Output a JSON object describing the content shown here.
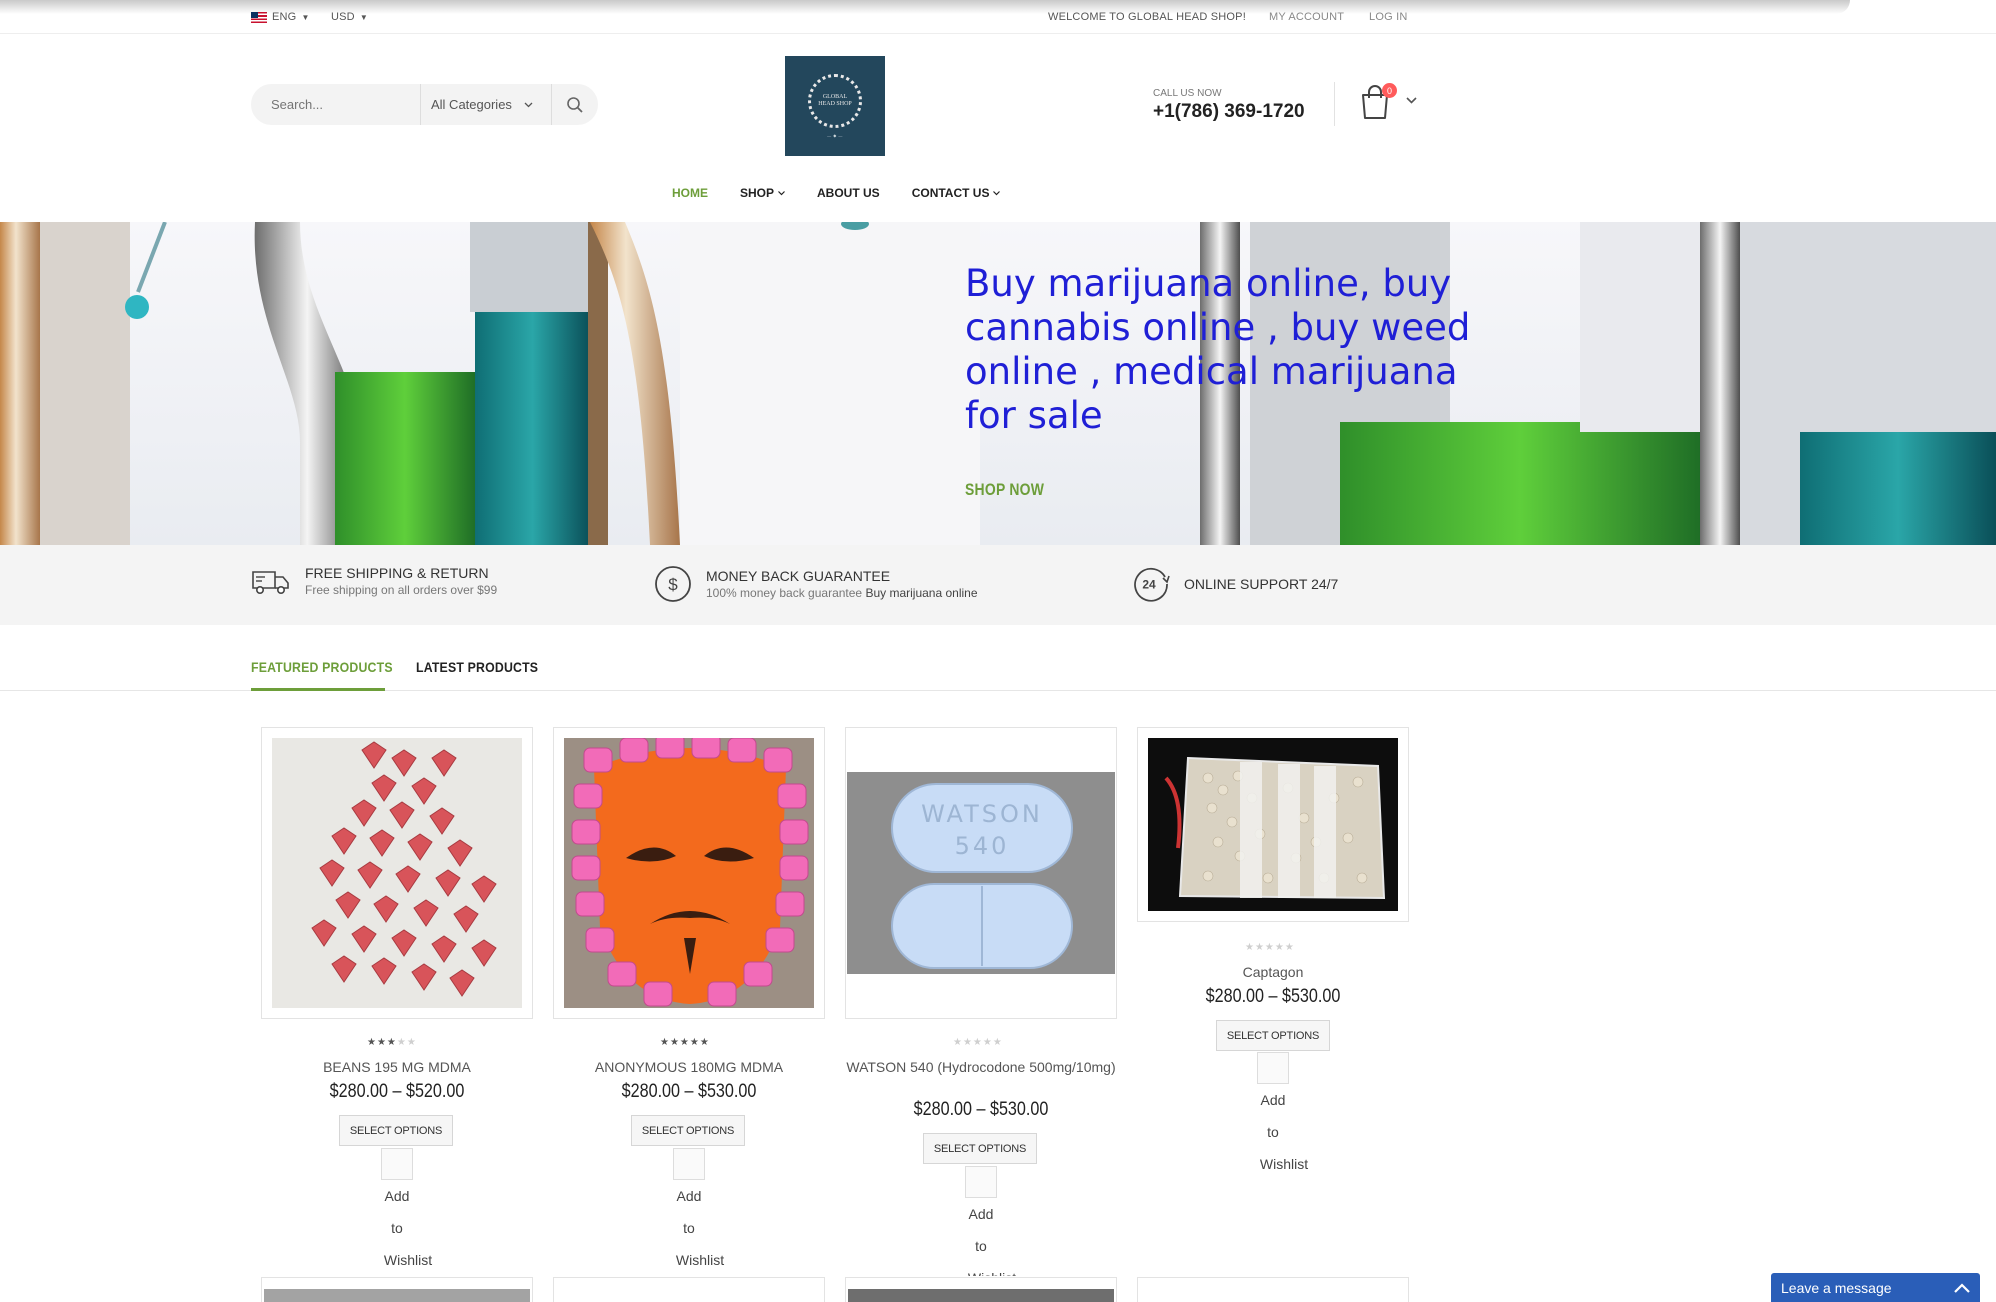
{
  "topbar": {
    "language": "ENG",
    "currency": "USD",
    "welcome": "WELCOME TO GLOBAL HEAD SHOP!",
    "my_account": "MY ACCOUNT",
    "login": "LOG IN"
  },
  "header": {
    "search_placeholder": "Search...",
    "category": "All Categories",
    "logo_text": "GLOBAL HEAD SHOP",
    "call_label": "CALL US NOW",
    "phone": "+1(786) 369-1720",
    "cart_count": "0"
  },
  "nav": {
    "items": [
      {
        "label": "HOME",
        "active": true,
        "dropdown": false
      },
      {
        "label": "SHOP",
        "active": false,
        "dropdown": true
      },
      {
        "label": "ABOUT US",
        "active": false,
        "dropdown": false
      },
      {
        "label": "CONTACT US",
        "active": false,
        "dropdown": true
      }
    ]
  },
  "hero": {
    "title": "Buy marijuana online, buy cannabis online , buy weed online , medical marijuana for sale",
    "cta": "SHOP NOW"
  },
  "features": [
    {
      "title": "FREE SHIPPING & RETURN",
      "subtitle": "Free shipping on all orders over $99",
      "extra": "",
      "icon": "truck-icon"
    },
    {
      "title": "MONEY BACK GUARANTEE",
      "subtitle": "100% money back guarantee",
      "extra": "Buy marijuana online",
      "icon": "dollar-circle-icon"
    },
    {
      "title": "ONLINE SUPPORT 24/7",
      "subtitle": "",
      "extra": "",
      "icon": "support-24-icon"
    }
  ],
  "tabs": {
    "featured": "FEATURED PRODUCTS",
    "latest": "LATEST PRODUCTS"
  },
  "products": [
    {
      "name": "BEANS 195 MG MDMA",
      "price": "$280.00 – $520.00",
      "rating": 3,
      "button": "SELECT OPTIONS",
      "wishlist": [
        "Add",
        "to",
        "Wishlist"
      ]
    },
    {
      "name": "ANONYMOUS 180MG MDMA",
      "price": "$280.00 – $530.00",
      "rating": 5,
      "button": "SELECT OPTIONS",
      "wishlist": [
        "Add",
        "to",
        "Wishlist"
      ]
    },
    {
      "name": "WATSON 540 (Hydrocodone 500mg/10mg)",
      "price": "$280.00 – $530.00",
      "rating": 0,
      "button": "SELECT OPTIONS",
      "wishlist": [
        "Add",
        "to",
        "Wishlist"
      ]
    },
    {
      "name": "Captagon",
      "price": "$280.00 – $530.00",
      "rating": 0,
      "button": "SELECT OPTIONS",
      "wishlist": [
        "Add",
        "to",
        "Wishlist"
      ]
    }
  ],
  "pill_imprint": {
    "line1": "WATSON",
    "line2": "540"
  },
  "chat": {
    "label": "Leave a message"
  },
  "colors": {
    "accent_green": "#6d9e3a",
    "hero_text": "#1f1fd6",
    "chat_blue": "#2a5eb8",
    "badge_red": "#ff5b5b"
  }
}
